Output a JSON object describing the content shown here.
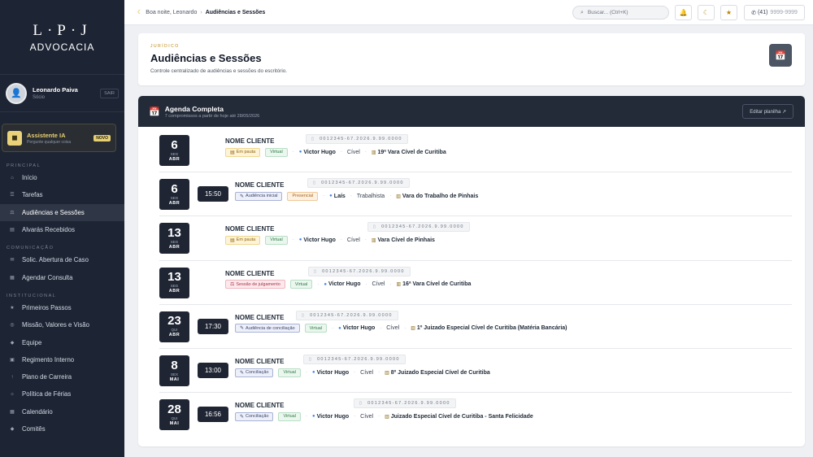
{
  "sidebar": {
    "logo_top": "L·P·J",
    "logo_bottom": "ADVOCACIA",
    "user": {
      "name": "Leonardo Paiva",
      "role": "Sócio",
      "logout": "SAIR"
    },
    "ai": {
      "title": "Assistente IA",
      "subtitle": "Pergunte qualquer coisa",
      "badge": "NOVO"
    },
    "sections": [
      {
        "title": "PRINCIPAL",
        "items": [
          {
            "label": "Início",
            "icon": "home-icon",
            "active": false
          },
          {
            "label": "Tarefas",
            "icon": "tasks-icon",
            "active": false
          },
          {
            "label": "Audiências e Sessões",
            "icon": "gavel-icon",
            "active": true
          },
          {
            "label": "Alvarás Recebidos",
            "icon": "document-icon",
            "active": false
          }
        ]
      },
      {
        "title": "COMUNICAÇÃO",
        "items": [
          {
            "label": "Solic. Abertura de Caso",
            "icon": "request-icon",
            "active": false
          },
          {
            "label": "Agendar Consulta",
            "icon": "calendar-add-icon",
            "active": false
          }
        ]
      },
      {
        "title": "INSTITUCIONAL",
        "items": [
          {
            "label": "Primeiros Passos",
            "icon": "star-icon",
            "active": false
          },
          {
            "label": "Missão, Valores e Visão",
            "icon": "target-icon",
            "active": false
          },
          {
            "label": "Equipe",
            "icon": "team-icon",
            "active": false
          },
          {
            "label": "Regimento Interno",
            "icon": "book-icon",
            "active": false
          },
          {
            "label": "Plano de Carreira",
            "icon": "arrow-up-icon",
            "active": false
          },
          {
            "label": "Política de Férias",
            "icon": "sun-icon",
            "active": false
          },
          {
            "label": "Calendário",
            "icon": "calendar-icon",
            "active": false
          },
          {
            "label": "Comitês",
            "icon": "group-icon",
            "active": false
          }
        ]
      }
    ]
  },
  "topbar": {
    "greeting": "Boa noite, Leonardo",
    "current": "Audiências e Sessões",
    "search_placeholder": "Buscar... (Ctrl+K)",
    "phone_code": "(41)",
    "phone_number": "9999-9999"
  },
  "header": {
    "kicker": "JURÍDICO",
    "title": "Audiências e Sessões",
    "subtitle": "Controle centralizado de audiências e sessões do escritório."
  },
  "agenda": {
    "title": "Agenda Completa",
    "subtitle": "7 compromissos a partir de hoje até 28/05/2026",
    "button": "Editar planilha ↗",
    "rows": [
      {
        "day": "6",
        "weekday": "SEG",
        "month": "ABR",
        "time": "",
        "client": "NOME CLIENTE",
        "process": "0012345-67.2026.9.99.0000",
        "type": "Em pauta",
        "type_style": "pauta",
        "mode": "Virtual",
        "mode_style": "virt",
        "lawyer": "Victor Hugo",
        "area": "Cível",
        "court": "19ª Vara Cível de Curitiba"
      },
      {
        "day": "6",
        "weekday": "SEG",
        "month": "ABR",
        "time": "15:50",
        "client": "NOME CLIENTE",
        "process": "0012345-67.2026.9.99.0000",
        "type": "Audiência inicial",
        "type_style": "aud",
        "mode": "Presencial",
        "mode_style": "pres",
        "lawyer": "Laís",
        "area": "Trabalhista",
        "court": "Vara do Trabalho de Pinhais"
      },
      {
        "day": "13",
        "weekday": "SEG",
        "month": "ABR",
        "time": "",
        "client": "NOME CLIENTE",
        "process": "0012345-67.2026.9.99.0000",
        "type": "Em pauta",
        "type_style": "pauta",
        "mode": "Virtual",
        "mode_style": "virt",
        "lawyer": "Victor Hugo",
        "area": "Cível",
        "court": "Vara Cível de Pinhais"
      },
      {
        "day": "13",
        "weekday": "SEG",
        "month": "ABR",
        "time": "",
        "client": "NOME CLIENTE",
        "process": "0012345-67.2026.9.99.0000",
        "type": "Sessão de julgamento",
        "type_style": "sess",
        "mode": "Virtual",
        "mode_style": "virt",
        "lawyer": "Victor Hugo",
        "area": "Cível",
        "court": "16ª Vara Cível de Curitiba"
      },
      {
        "day": "23",
        "weekday": "QUI",
        "month": "ABR",
        "time": "17:30",
        "client": "NOME CLIENTE",
        "process": "0012345-67.2026.9.99.0000",
        "type": "Audiência de conciliação",
        "type_style": "aud",
        "mode": "Virtual",
        "mode_style": "virt",
        "lawyer": "Victor Hugo",
        "area": "Cível",
        "court": "1º Juizado Especial Cível de Curitiba (Matéria Bancária)"
      },
      {
        "day": "8",
        "weekday": "SEX",
        "month": "MAI",
        "time": "13:00",
        "client": "NOME CLIENTE",
        "process": "0012345-67.2026.9.99.0000",
        "type": "Conciliação",
        "type_style": "aud",
        "mode": "Virtual",
        "mode_style": "virt",
        "lawyer": "Victor Hugo",
        "area": "Cível",
        "court": "8º Juizado Especial Cível de Curitiba"
      },
      {
        "day": "28",
        "weekday": "QUI",
        "month": "MAI",
        "time": "16:56",
        "client": "NOME CLIENTE",
        "process": "0012345-67.2026.9.99.0000",
        "type": "Conciliação",
        "type_style": "aud",
        "mode": "Virtual",
        "mode_style": "virt",
        "lawyer": "Victor Hugo",
        "area": "Cível",
        "court": "Juizado Especial Cível de Curitiba - Santa Felicidade"
      }
    ]
  }
}
